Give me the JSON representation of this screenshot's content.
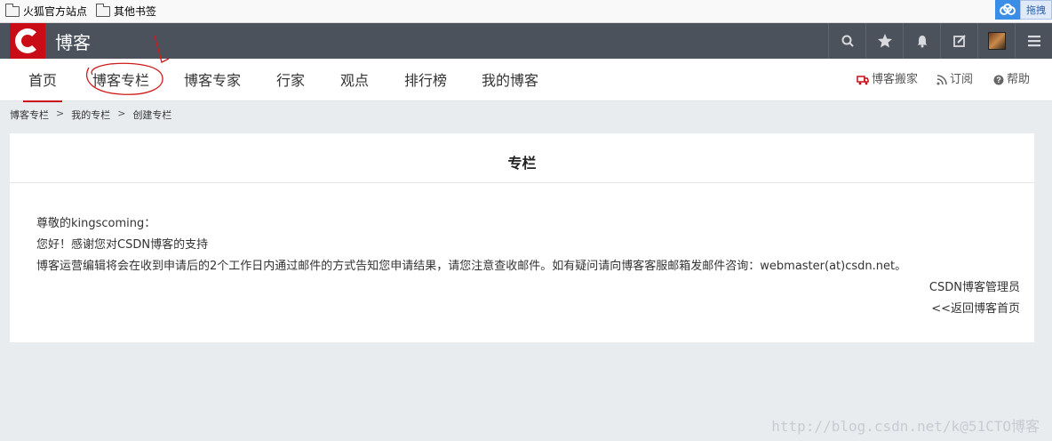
{
  "bookmarks": [
    {
      "label": "火狐官方站点",
      "icon": "folder-icon"
    },
    {
      "label": "其他书签",
      "icon": "folder-icon"
    }
  ],
  "extension": {
    "drag_label": "拖拽"
  },
  "header": {
    "site_title": "博客"
  },
  "top_icons": [
    "search-icon",
    "star-icon",
    "bell-icon",
    "edit-icon",
    "avatar",
    "menu-icon"
  ],
  "nav": {
    "items": [
      "首页",
      "博客专栏",
      "博客专家",
      "行家",
      "观点",
      "排行榜",
      "我的博客"
    ],
    "active": "首页",
    "right": {
      "move": "博客搬家",
      "subscribe": "订阅",
      "help": "帮助"
    }
  },
  "breadcrumb": [
    "博客专栏",
    "我的专栏",
    "创建专栏"
  ],
  "card": {
    "title": "专栏",
    "greeting": "尊敬的kingscoming：",
    "thanks": "您好！感谢您对CSDN博客的支持",
    "body": "博客运营编辑将会在收到申请后的2个工作日内通过邮件的方式告知您申请结果，请您注意查收邮件。如有疑问请向博客客服邮箱发邮件咨询：webmaster(at)csdn.net。",
    "signature": "CSDN博客管理员",
    "back_link": "<<返回博客首页"
  },
  "watermark": "http://blog.csdn.net/k@51CTO博客",
  "colors": {
    "brand_red": "#ca0c16",
    "header_bg": "#4b525c",
    "page_bg": "#e8ecef"
  }
}
